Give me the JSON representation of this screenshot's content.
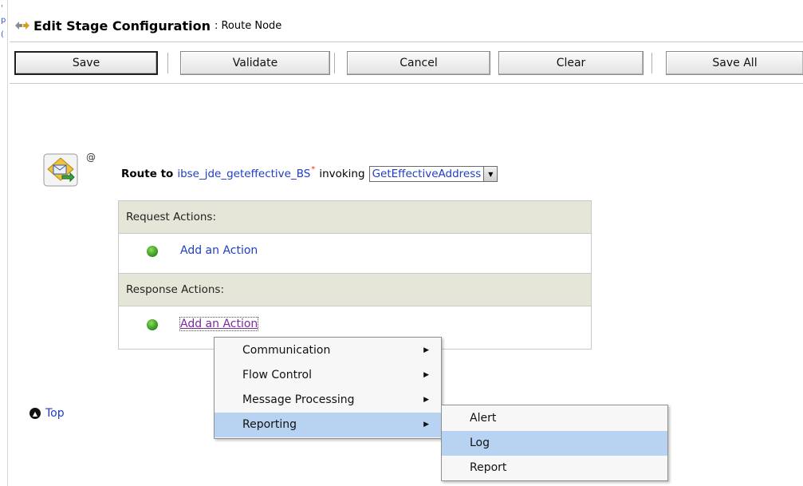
{
  "window": {
    "title": "Edit Stage Configuration",
    "subtitle": ": Route Node"
  },
  "toolbar": {
    "save_label": "Save",
    "validate_label": "Validate",
    "cancel_label": "Cancel",
    "clear_label": "Clear",
    "save_all_label": "Save All"
  },
  "route": {
    "route_to_label": "Route to",
    "service_name": "ibse_jde_geteffective_BS",
    "required_marker": "*",
    "invoking_label": "invoking",
    "operation_selected": "GetEffectiveAddress",
    "icon_at": "@"
  },
  "request_section": {
    "header": "Request Actions:",
    "add_action": "Add an Action"
  },
  "response_section": {
    "header": "Response Actions:",
    "add_action": "Add an Action"
  },
  "context_menu": {
    "items": [
      {
        "label": "Communication",
        "has_submenu": true,
        "selected": false
      },
      {
        "label": "Flow Control",
        "has_submenu": true,
        "selected": false
      },
      {
        "label": "Message Processing",
        "has_submenu": true,
        "selected": false
      },
      {
        "label": "Reporting",
        "has_submenu": true,
        "selected": true
      }
    ]
  },
  "submenu": {
    "items": [
      {
        "label": "Alert",
        "selected": false
      },
      {
        "label": "Log",
        "selected": true
      },
      {
        "label": "Report",
        "selected": false
      }
    ]
  },
  "footer": {
    "top_link": "Top"
  },
  "colors": {
    "link": "#1f3fbf",
    "visited_link": "#7a2a9a",
    "section_header_bg": "#e6e6d8",
    "menu_highlight": "#b7d3f1",
    "required_marker": "#ff2d00"
  },
  "icons": [
    "stage-icon",
    "route-node-icon",
    "status-dot-icon",
    "submenu-arrow-icon",
    "dropdown-arrow-icon",
    "top-arrow-icon"
  ]
}
